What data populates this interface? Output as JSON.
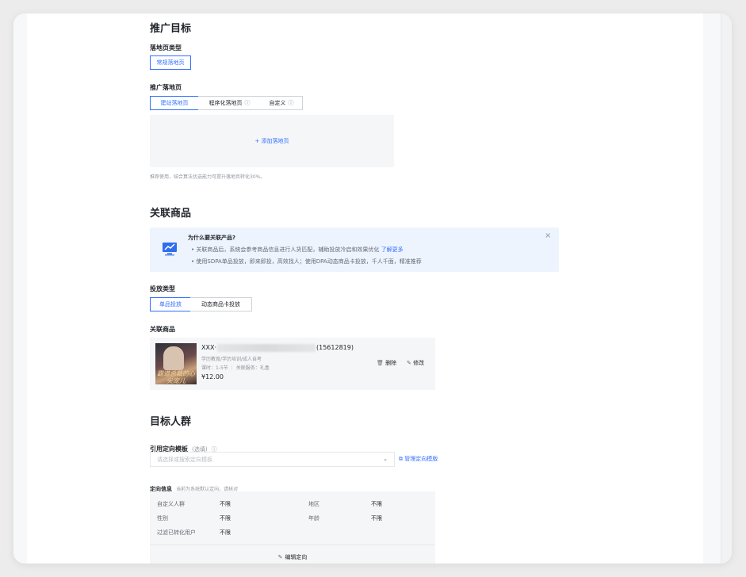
{
  "promo_goal": {
    "title": "推广目标",
    "landing_type_label": "落地页类型",
    "landing_type_value": "常规落地页",
    "landing_page_label": "推广落地页",
    "tabs": [
      {
        "label": "建站落地页"
      },
      {
        "label": "程序化落地页"
      },
      {
        "label": "自定义"
      }
    ],
    "add_landing": "+ 添加落地页",
    "hint": "推荐使用，结合算法优选能力可提升落地页转化30%。"
  },
  "linked_product": {
    "title": "关联商品",
    "notice": {
      "title": "为什么要关联产品?",
      "line1": "关联商品后，系统会参考商品信息进行人货匹配，辅助投放冷启和效果优化",
      "line1_link": "了解更多",
      "line2": "使用SDPA单品投放，即来即投，高效找人；使用DPA动态商品卡投放，千人千面，精准推荐"
    },
    "delivery_type_label": "投放类型",
    "delivery_types": [
      {
        "label": "单品投放"
      },
      {
        "label": "动态商品卡投放"
      }
    ],
    "product_label": "关联商品",
    "product": {
      "name": "XXX·",
      "id": "(15612819)",
      "category": "学历教育/学历培训/成人自考",
      "meta_hours": "课时：1-5节",
      "meta_service": "关联服务：礼盒",
      "price": "¥12.00",
      "cover_text": "霸道总裁的心尖宠儿",
      "delete": "删除",
      "edit": "修改"
    }
  },
  "target_audience": {
    "title": "目标人群",
    "template_label": "引用定向模板",
    "template_optional": "(选填)",
    "template_placeholder": "请选择或搜索定向模板",
    "manage_link": "管理定向模版",
    "info_label": "定向信息",
    "info_hint": "当前为系统默认定向，请核对",
    "rows": [
      {
        "key": "自定义人群",
        "value": "不限"
      },
      {
        "key": "性别",
        "value": "不限"
      },
      {
        "key": "过滤已转化用户",
        "value": "不限"
      },
      {
        "key": "地区",
        "value": "不限"
      },
      {
        "key": "年龄",
        "value": "不限"
      }
    ],
    "edit_button": "编辑定向"
  },
  "colors": {
    "accent": "#3370ff",
    "notice_bg": "#eef4fe",
    "card_bg": "#f5f6f7"
  }
}
